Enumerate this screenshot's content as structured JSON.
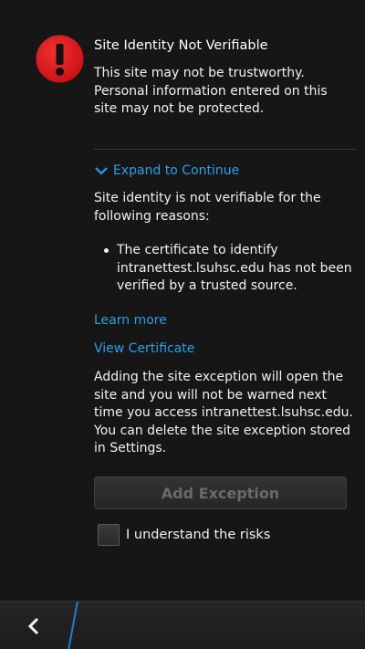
{
  "dialog": {
    "title": "Site Identity Not Verifiable",
    "warning": "This site may not be trustworthy. Personal information entered on this site may not be protected.",
    "alert_icon": "exclamation-circle-icon",
    "alert_color": "#e0191c"
  },
  "expand": {
    "label": "Expand to Continue",
    "icon": "chevron-down-icon"
  },
  "details": {
    "intro": "Site identity is not verifiable for the following reasons:",
    "reasons": [
      "The certificate to identify intranettest.lsuhsc.edu has not been verified by a trusted source."
    ],
    "learn_more": "Learn more",
    "view_certificate": "View Certificate",
    "exception_info": "Adding the site exception will open the site and you will not be warned next time you access intranettest.lsuhsc.edu. You can delete the site exception stored in Settings."
  },
  "actions": {
    "add_exception": "Add Exception",
    "understand_risks": "I understand the risks",
    "understand_risks_checked": false
  },
  "action_bar": {
    "back_icon": "back-arrow-icon"
  },
  "colors": {
    "link": "#2e9fe6",
    "background": "#161616",
    "accent": "#1e7fd0"
  }
}
